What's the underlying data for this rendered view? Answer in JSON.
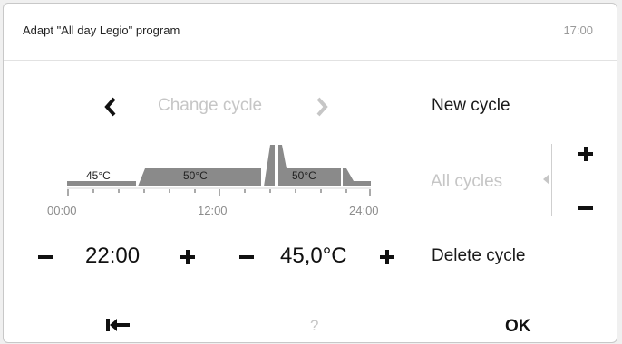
{
  "header": {
    "title": "Adapt \"All day Legio\" program",
    "time": "17:00"
  },
  "cycle_nav": {
    "prev_icon": "chevron-left-icon",
    "label": "Change cycle",
    "next_icon": "chevron-right-icon"
  },
  "schedule": {
    "segments": [
      {
        "label": "45°C",
        "temp_level": "low"
      },
      {
        "label": "50°C",
        "temp_level": "high"
      },
      {
        "label": "50°C",
        "temp_level": "high"
      }
    ],
    "axis_labels": [
      "00:00",
      "12:00",
      "24:00"
    ]
  },
  "side_actions": {
    "new_cycle": "New cycle",
    "all_cycles": "All cycles",
    "delete_cycle": "Delete cycle"
  },
  "time_stepper": {
    "value": "22:00",
    "minus_icon": "minus-icon",
    "plus_icon": "plus-icon"
  },
  "temp_stepper": {
    "value": "45,0°C",
    "minus_icon": "minus-icon",
    "plus_icon": "plus-icon"
  },
  "footer": {
    "back_icon": "back-arrow-icon",
    "help_label": "?",
    "ok_label": "OK"
  },
  "colors": {
    "bar_fill": "#8a8a8a",
    "disabled_text": "#c6c6c6",
    "text": "#1a1a1a"
  }
}
